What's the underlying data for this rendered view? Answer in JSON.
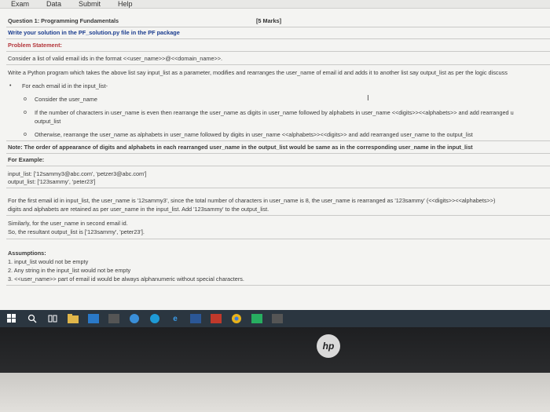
{
  "menu": [
    "Exam",
    "Data",
    "Submit",
    "Help"
  ],
  "question": {
    "title": "Question 1: Programming Fundamentals",
    "marks": "[5 Marks]",
    "write_solution": "Write your solution in the PF_solution.py file in the PF package",
    "problem_heading": "Problem Statement:",
    "consider_list": "Consider a list of valid email ids in the format <<user_name>>@<<domain_name>>.",
    "write_program": "Write a Python program which takes the above list say input_list as a parameter, modifies and rearranges the user_name of email id and adds it to another list say output_list as per the logic discuss",
    "for_each": "For each email id in the input_list-",
    "consider_user": "Consider the user_name",
    "if_even_1": "If the number of characters in user_name is even then rearrange the user_name as digits in user_name followed by alphabets in user_name <<digits>><<alphabets>> and add rearranged u",
    "if_even_2": "output_list",
    "otherwise": "Otherwise, rearrange the user_name as alphabets in user_name followed by digits in user_name <<alphabets>><<digits>> and add rearranged user_name to the output_list",
    "note": "Note: The order of appearance of digits and alphabets in each rearranged user_name in the output_list would be same as in the corresponding user_name in the input_list",
    "example_heading": "For Example:",
    "input_example": "input_list: ['12sammy3@abc.com', 'petzer3@abc.com']",
    "output_example": "output_list: ['123sammy', 'peter23']",
    "first_email_1": "For the first email id in input_list, the user_name is '12sammy3', since the total number of characters in user_name is 8, the user_name is rearranged as '123sammy' (<<digits>><<alphabets>>)",
    "first_email_2": "digits and alphabets are retained as per user_name in the input_list. Add '123sammy' to the output_list.",
    "similarly": "Similarly, for the user_name in second email id.",
    "so_result": "So, the resultant output_list is ['123sammy', 'peter23'].",
    "assumptions_heading": "Assumptions:",
    "assumptions": [
      "1.  input_list would not be empty",
      "2.  Any string in the input_list would not be empty",
      "3.  <<user_name>> part of email id would be always alphanumeric without special characters."
    ]
  },
  "brand": "hp"
}
